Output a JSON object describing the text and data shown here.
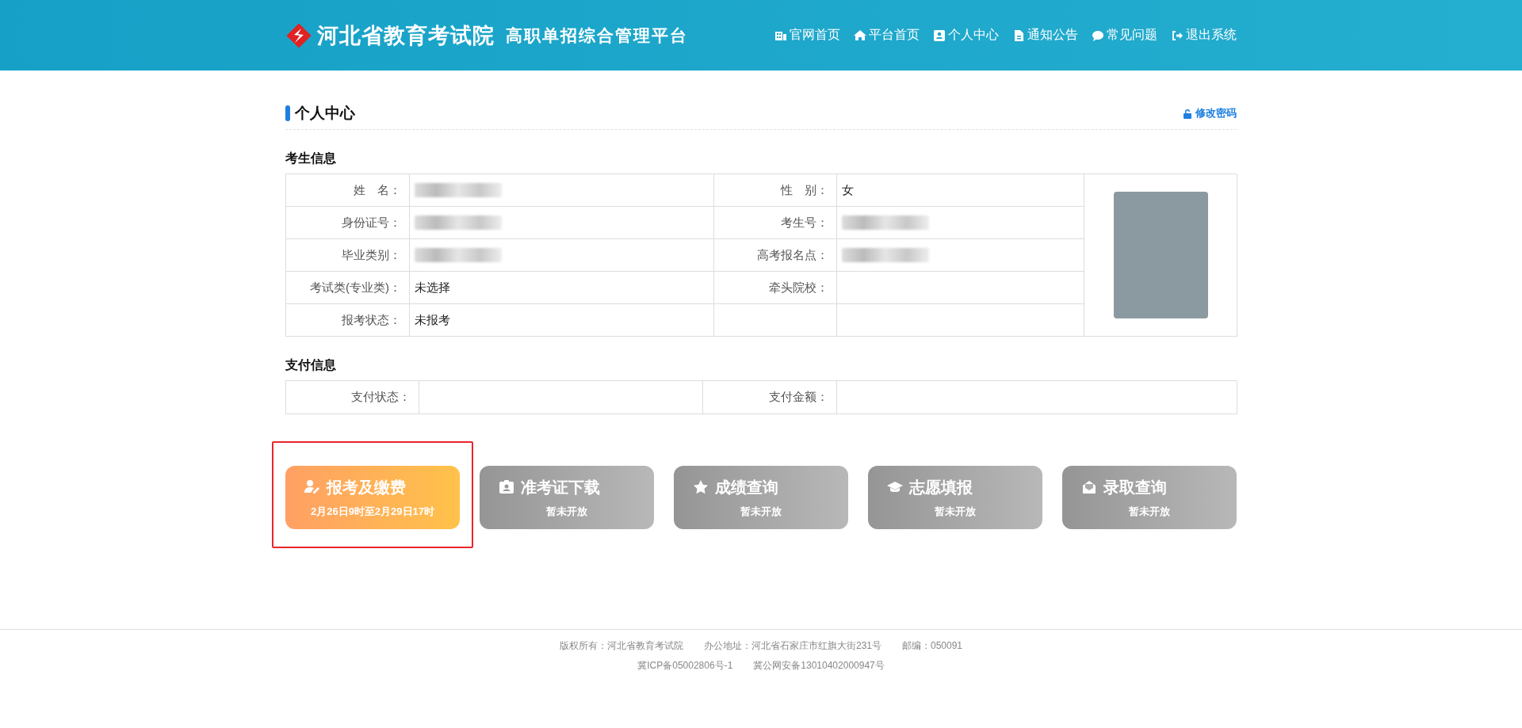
{
  "header": {
    "logo_name": "河北省教育考试院",
    "platform_name": "高职单招综合管理平台",
    "nav": [
      {
        "label": "官网首页"
      },
      {
        "label": "平台首页"
      },
      {
        "label": "个人中心"
      },
      {
        "label": "通知公告"
      },
      {
        "label": "常见问题"
      },
      {
        "label": "退出系统"
      }
    ]
  },
  "page": {
    "title": "个人中心",
    "change_password": "修改密码"
  },
  "student_info": {
    "heading": "考生信息",
    "rows": [
      {
        "cells": [
          {
            "label": "姓　名：",
            "value": {
              "kind": "blurred"
            }
          },
          {
            "label": "性　别：",
            "value": {
              "kind": "text",
              "text": "女"
            }
          }
        ]
      },
      {
        "cells": [
          {
            "label": "身份证号：",
            "value": {
              "kind": "blurred"
            }
          },
          {
            "label": "考生号：",
            "value": {
              "kind": "blurred"
            }
          }
        ]
      },
      {
        "cells": [
          {
            "label": "毕业类别：",
            "value": {
              "kind": "blurred"
            }
          },
          {
            "label": "高考报名点：",
            "value": {
              "kind": "blurred"
            }
          }
        ]
      },
      {
        "cells": [
          {
            "label": "考试类(专业类)：",
            "value": {
              "kind": "text",
              "text": "未选择"
            }
          },
          {
            "label": "牵头院校：",
            "value": {
              "kind": "empty"
            }
          }
        ]
      },
      {
        "cells": [
          {
            "label": "报考状态：",
            "value": {
              "kind": "text",
              "text": "未报考"
            }
          }
        ]
      }
    ]
  },
  "payment_info": {
    "heading": "支付信息",
    "cells": [
      {
        "label": "支付状态："
      },
      {
        "label": "支付金额："
      }
    ]
  },
  "actions": [
    {
      "title": "报考及缴费",
      "subtitle": "2月26日9时至2月29日17时",
      "available": true,
      "highlighted": true
    },
    {
      "title": "准考证下载",
      "subtitle": "暂未开放",
      "available": false,
      "highlighted": false
    },
    {
      "title": "成绩查询",
      "subtitle": "暂未开放",
      "available": false,
      "highlighted": false
    },
    {
      "title": "志愿填报",
      "subtitle": "暂未开放",
      "available": false,
      "highlighted": false
    },
    {
      "title": "录取查询",
      "subtitle": "暂未开放",
      "available": false,
      "highlighted": false
    }
  ],
  "footer": {
    "lines": [
      [
        "版权所有：河北省教育考试院",
        "办公地址：河北省石家庄市红旗大街231号",
        "邮编：050091"
      ],
      [
        "冀ICP备05002806号-1",
        "冀公网安备13010402000947号"
      ]
    ]
  }
}
